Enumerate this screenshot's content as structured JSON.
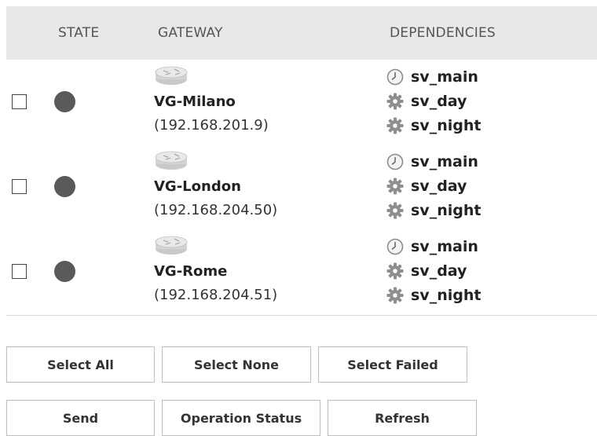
{
  "table": {
    "headers": {
      "state": "STATE",
      "gateway": "GATEWAY",
      "dependencies": "DEPENDENCIES"
    },
    "rows": [
      {
        "name": "VG-Milano",
        "ip": "(192.168.201.9)",
        "state_color": "#5a5a5a",
        "dependencies": [
          {
            "label": "sv_main",
            "icon": "clock-icon"
          },
          {
            "label": "sv_day",
            "icon": "gear-icon"
          },
          {
            "label": "sv_night",
            "icon": "gear-icon"
          }
        ]
      },
      {
        "name": "VG-London",
        "ip": "(192.168.204.50)",
        "state_color": "#5a5a5a",
        "dependencies": [
          {
            "label": "sv_main",
            "icon": "clock-icon"
          },
          {
            "label": "sv_day",
            "icon": "gear-icon"
          },
          {
            "label": "sv_night",
            "icon": "gear-icon"
          }
        ]
      },
      {
        "name": "VG-Rome",
        "ip": "(192.168.204.51)",
        "state_color": "#5a5a5a",
        "dependencies": [
          {
            "label": "sv_main",
            "icon": "clock-icon"
          },
          {
            "label": "sv_day",
            "icon": "gear-icon"
          },
          {
            "label": "sv_night",
            "icon": "gear-icon"
          }
        ]
      }
    ]
  },
  "buttons": {
    "select_all": "Select All",
    "select_none": "Select None",
    "select_failed": "Select Failed",
    "send": "Send",
    "operation_status": "Operation Status",
    "refresh": "Refresh"
  }
}
